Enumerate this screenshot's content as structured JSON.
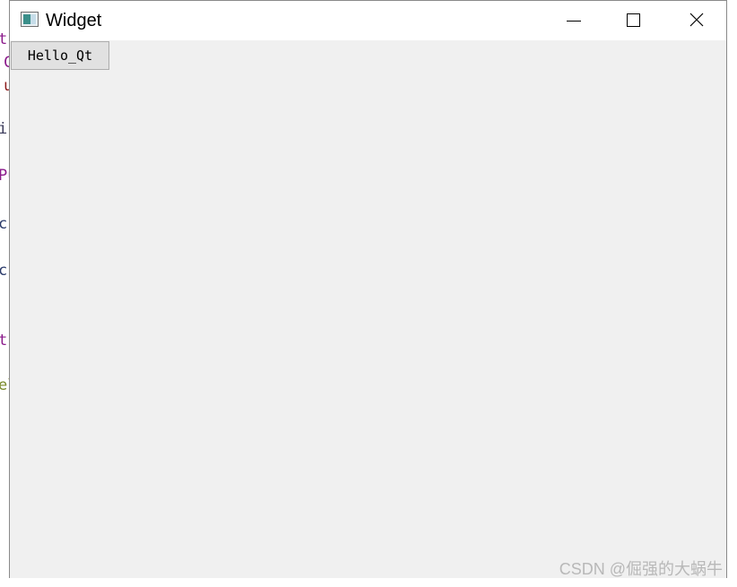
{
  "window": {
    "title": "Widget"
  },
  "title_bar": {
    "icons": [
      "app-icon",
      "minimize-icon",
      "maximize-icon",
      "close-icon"
    ]
  },
  "content": {
    "button_label": "Hello_Qt"
  },
  "background_code": [
    "t:",
    "C",
    "u",
    "i-",
    "Pu",
    "cr",
    "cr",
    "t:",
    "el"
  ],
  "watermark": "CSDN @倔强的大蜗牛",
  "colors": {
    "client_background": "#f0f0f0",
    "button_background": "#e1e1e1",
    "button_border": "#adadad"
  }
}
